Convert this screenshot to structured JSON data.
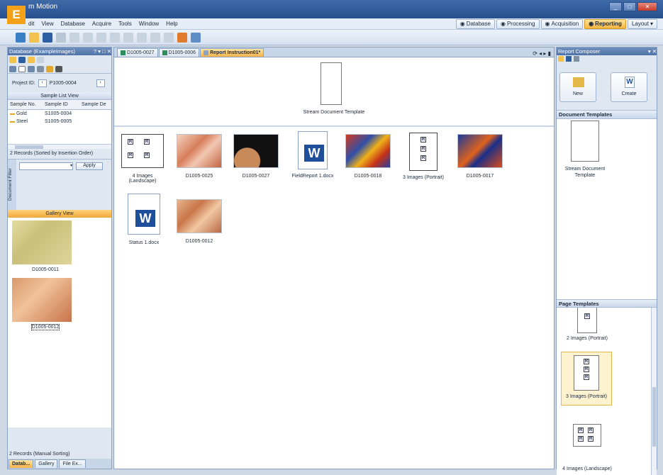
{
  "app": {
    "title": "m Motion",
    "label": "E"
  },
  "menu": [
    "dit",
    "View",
    "Database",
    "Acquire",
    "Tools",
    "Window",
    "Help"
  ],
  "workspaces": [
    {
      "label": "Database",
      "active": false
    },
    {
      "label": "Processing",
      "active": false
    },
    {
      "label": "Acquisition",
      "active": false
    },
    {
      "label": "Reporting",
      "active": true
    },
    {
      "label": "Layout",
      "active": false
    }
  ],
  "left": {
    "header": "Database (ExampleImages)",
    "project_label": "Project ID:",
    "project_value": "P1005-0004",
    "sample_list_title": "Sample List View",
    "columns": [
      "Sample No.",
      "Sample ID",
      "Sample De"
    ],
    "rows": [
      {
        "no": "Gold",
        "id": "S1005-0004"
      },
      {
        "no": "Steel",
        "id": "S1005-0005"
      }
    ],
    "records_info": "2 Records (Sorted by Insertion Order)",
    "filter_label": "Document Filter",
    "apply_label": "Apply",
    "gallery_title": "Gallery View",
    "gallery": [
      {
        "label": "D1005-0011"
      },
      {
        "label": "D1005-0012"
      }
    ],
    "bottom_records": "2 Records (Manual Sorting)",
    "bottom_tabs": [
      "Datab...",
      "Gallery",
      "File Ex..."
    ]
  },
  "center": {
    "tabs": [
      {
        "label": "D1005-0027",
        "active": false
      },
      {
        "label": "D1005-0006",
        "active": false
      },
      {
        "label": "Report Instruction01*",
        "active": true
      }
    ],
    "template_label": "Stream Document Template",
    "items": [
      {
        "label": "4 Images (Landscape)",
        "kind": "grid4"
      },
      {
        "label": "D1005-0025",
        "kind": "photo-orange"
      },
      {
        "label": "D1005-0027",
        "kind": "photo-dark"
      },
      {
        "label": "FieldReport 1.docx",
        "kind": "word"
      },
      {
        "label": "D1005-0018",
        "kind": "photo-blue"
      },
      {
        "label": "3 Images (Portrait)",
        "kind": "grid3"
      },
      {
        "label": "D1005-0017",
        "kind": "photo-blue2"
      },
      {
        "label": "Status 1.docx",
        "kind": "word"
      },
      {
        "label": "D1005-0012",
        "kind": "photo-orange2"
      }
    ]
  },
  "right": {
    "header": "Report Composer",
    "new_label": "New",
    "create_label": "Create",
    "doc_templates_title": "Document Templates",
    "doc_template_label": "Stream Document Template",
    "page_templates_title": "Page Templates",
    "page_templates": [
      {
        "label": "2 Images (Portrait)",
        "selected": false
      },
      {
        "label": "3 Images (Portrait)",
        "selected": true
      },
      {
        "label": "4 Images (Landscape)",
        "selected": false
      }
    ]
  }
}
